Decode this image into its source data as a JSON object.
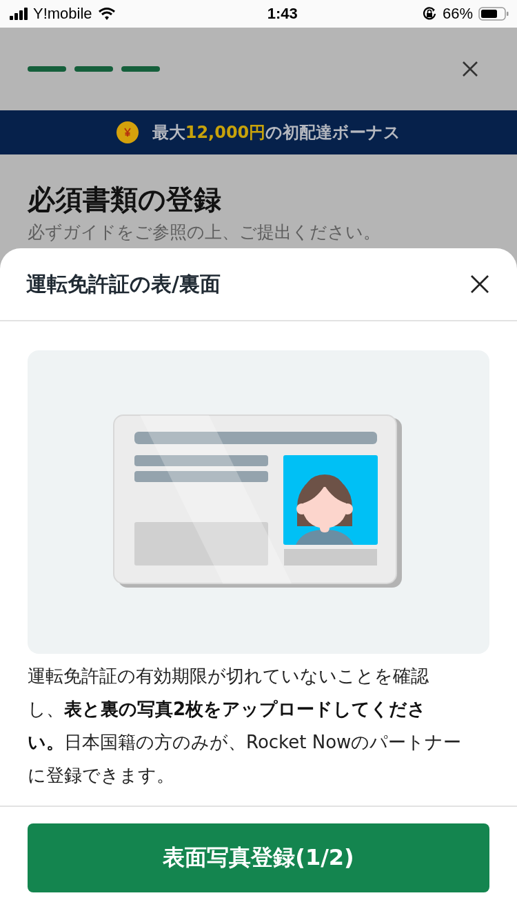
{
  "status_bar": {
    "carrier": "Y!mobile",
    "time": "1:43",
    "battery": "66%"
  },
  "progress_steps": [
    {
      "done": true
    },
    {
      "done": true
    },
    {
      "done": true
    }
  ],
  "banner": {
    "text": "最大**12,000円**の初配達ボーナス"
  },
  "page": {
    "title": "必須書類の登録",
    "subtitle": "必ずガイドをご参照の上、ご提出ください。"
  },
  "sheet": {
    "title": "運転免許証の表/裏面",
    "description": "運転免許証の有効期限が切れていないことを確認し、**表と裏の写真2枚をアップロードしてください。**日本国籍の方のみが、Rocket Nowのパートナーに登録できます。",
    "button": "表面写真登録(1/2)"
  }
}
